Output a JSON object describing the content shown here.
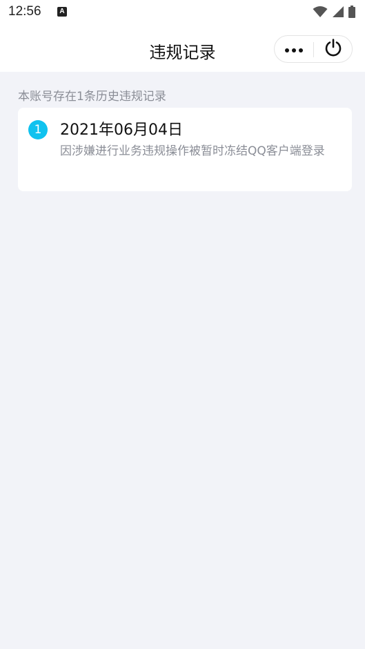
{
  "status_bar": {
    "time": "12:56",
    "notification_glyph": "A",
    "icons": [
      "wifi-icon",
      "signal-icon",
      "battery-icon"
    ]
  },
  "nav": {
    "title": "违规记录",
    "more_icon": "more-dots-icon",
    "power_icon": "power-icon"
  },
  "summary": "本账号存在1条历史违规记录",
  "records": [
    {
      "index": "1",
      "date": "2021年06月04日",
      "description": "因涉嫌进行业务违规操作被暂时冻结QQ客户端登录"
    }
  ],
  "colors": {
    "accent": "#10c2ef",
    "background": "#f2f3f8",
    "secondary_text": "#8a8d96"
  }
}
